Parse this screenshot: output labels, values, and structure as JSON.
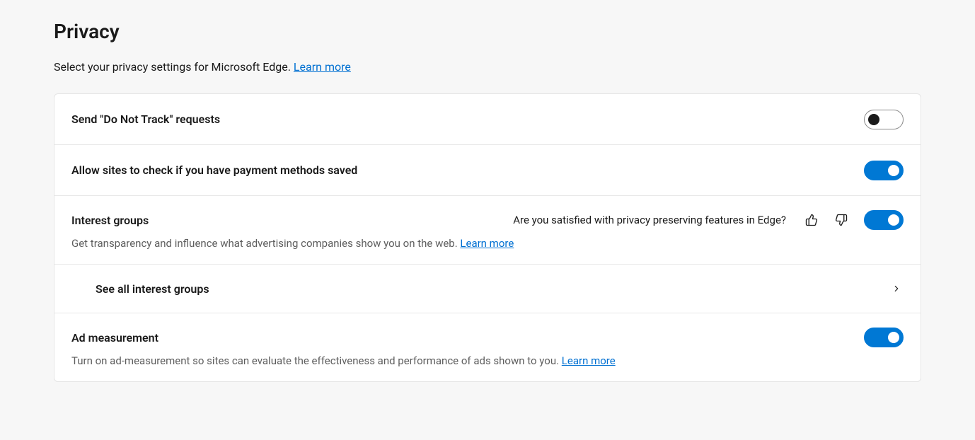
{
  "page": {
    "title": "Privacy",
    "description": "Select your privacy settings for Microsoft Edge. ",
    "learn_more": "Learn more"
  },
  "settings": {
    "do_not_track": {
      "label": "Send \"Do Not Track\" requests",
      "enabled": false
    },
    "payment_methods": {
      "label": "Allow sites to check if you have payment methods saved",
      "enabled": true
    },
    "interest_groups": {
      "label": "Interest groups",
      "description": "Get transparency and influence what advertising companies show you on the web. ",
      "learn_more": "Learn more",
      "enabled": true,
      "feedback_prompt": "Are you satisfied with privacy preserving features in Edge?",
      "see_all_label": "See all interest groups"
    },
    "ad_measurement": {
      "label": "Ad measurement",
      "description": "Turn on ad-measurement so sites can evaluate the effectiveness and performance of ads shown to you. ",
      "learn_more": "Learn more",
      "enabled": true
    }
  }
}
